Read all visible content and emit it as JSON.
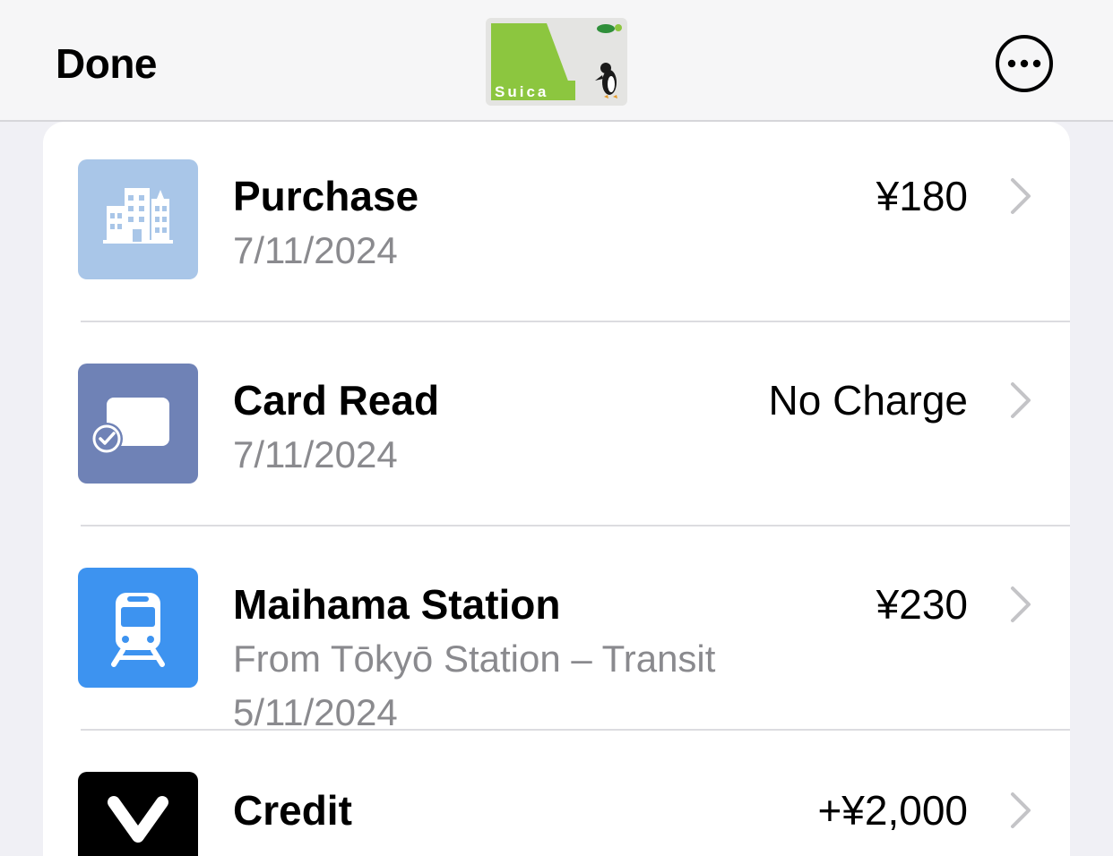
{
  "nav": {
    "done_label": "Done",
    "card_name": "Suica",
    "more_icon": "ellipsis-circle-icon"
  },
  "transactions": [
    {
      "title": "Purchase",
      "lines": [
        "7/11/2024"
      ],
      "amount": "¥180",
      "icon": "buildings-icon",
      "icon_bg": "#a9c6e8"
    },
    {
      "title": "Card Read",
      "lines": [
        "7/11/2024"
      ],
      "amount": "No Charge",
      "icon": "card-check-icon",
      "icon_bg": "#6f82b6"
    },
    {
      "title": "Maihama Station",
      "lines": [
        "From Tōkyō Station – Transit",
        "5/11/2024"
      ],
      "amount": "¥230",
      "icon": "train-icon",
      "icon_bg": "#3d93f0"
    },
    {
      "title": "Credit",
      "lines": [],
      "amount": "+¥2,000",
      "icon": "brand-logo-icon",
      "icon_bg": "#000000"
    }
  ],
  "colors": {
    "suica_green": "#8cc63f",
    "secondary_text": "#8a8a8e",
    "separator": "#dcdce0"
  }
}
